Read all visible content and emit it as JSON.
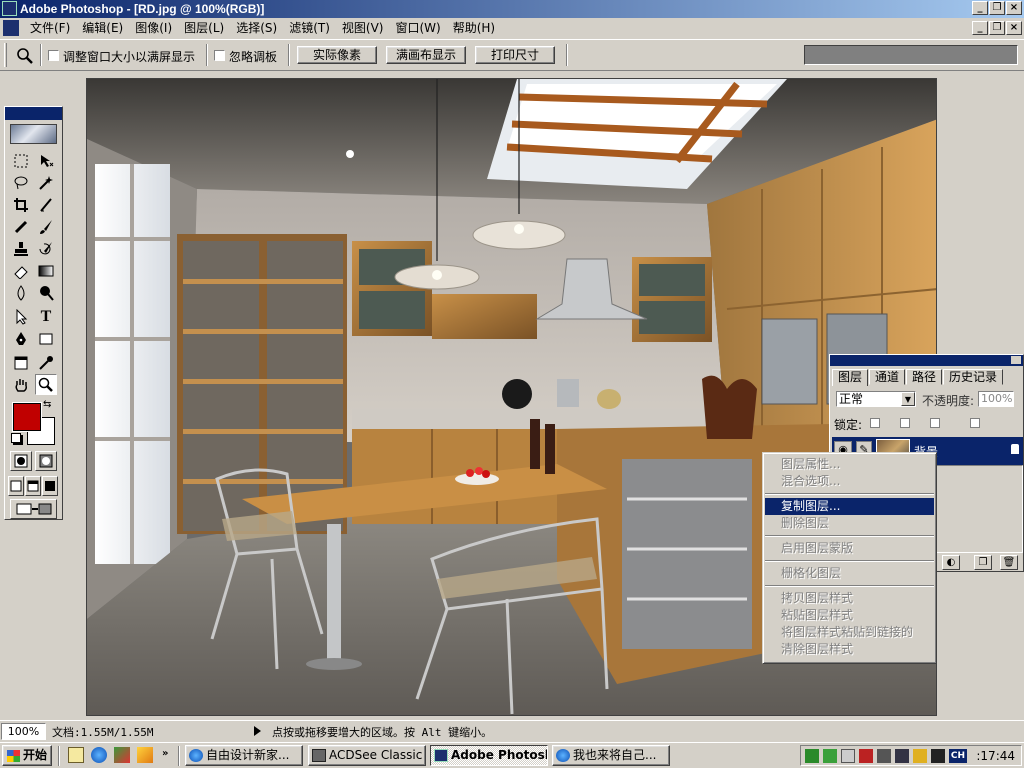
{
  "window": {
    "title": "Adobe Photoshop - [RD.jpg @ 100%(RGB)]",
    "controls": [
      "minimize-icon",
      "restore-icon",
      "close-icon"
    ]
  },
  "menu": {
    "items": [
      "文件(F)",
      "编辑(E)",
      "图像(I)",
      "图层(L)",
      "选择(S)",
      "滤镜(T)",
      "视图(V)",
      "窗口(W)",
      "帮助(H)"
    ]
  },
  "options": {
    "tool_icon": "zoom-icon",
    "resize_windows_label": "调整窗口大小以满屏显示",
    "ignore_palettes_label": "忽略调板",
    "resize_windows_checked": false,
    "ignore_palettes_checked": false,
    "actual_pixels_button": "实际像素",
    "fit_on_screen_button": "满画布显示",
    "print_size_button": "打印尺寸"
  },
  "toolbox": {
    "foreground_color": "#c00000",
    "background_color": "#ffffff",
    "active_tool": "zoom-icon"
  },
  "layers_panel": {
    "tabs": [
      "图层",
      "通道",
      "路径",
      "历史记录"
    ],
    "active_tab": "图层",
    "blend_mode": "正常",
    "opacity_label": "不透明度:",
    "opacity_value": "100%",
    "lock_label": "锁定:",
    "layer_name": "背景"
  },
  "context_menu": {
    "groups": [
      [
        "图层属性...",
        "混合选项..."
      ],
      [
        "复制图层...",
        "删除图层"
      ],
      [
        "启用图层蒙版"
      ],
      [
        "栅格化图层"
      ],
      [
        "拷贝图层样式",
        "粘贴图层样式",
        "将图层样式粘贴到链接的",
        "清除图层样式"
      ]
    ],
    "highlighted": "复制图层..."
  },
  "status": {
    "zoom": "100%",
    "doc_info": "文档:1.55M/1.55M",
    "hint": "点按或拖移要增大的区域。按 Alt 键缩小。"
  },
  "taskbar": {
    "start_label": "开始",
    "tasks": [
      "自由设计新家...",
      "ACDSee Classic -...",
      "Adobe Photosho...",
      "我也来将自己..."
    ],
    "active_task": "Adobe Photosho...",
    "tray_lang": "CH",
    "clock": ":17:44"
  },
  "colors": {
    "titlebar_start": "#0a246a",
    "titlebar_end": "#a6caf0",
    "selection": "#0a246a",
    "face": "#d4d0c8"
  }
}
